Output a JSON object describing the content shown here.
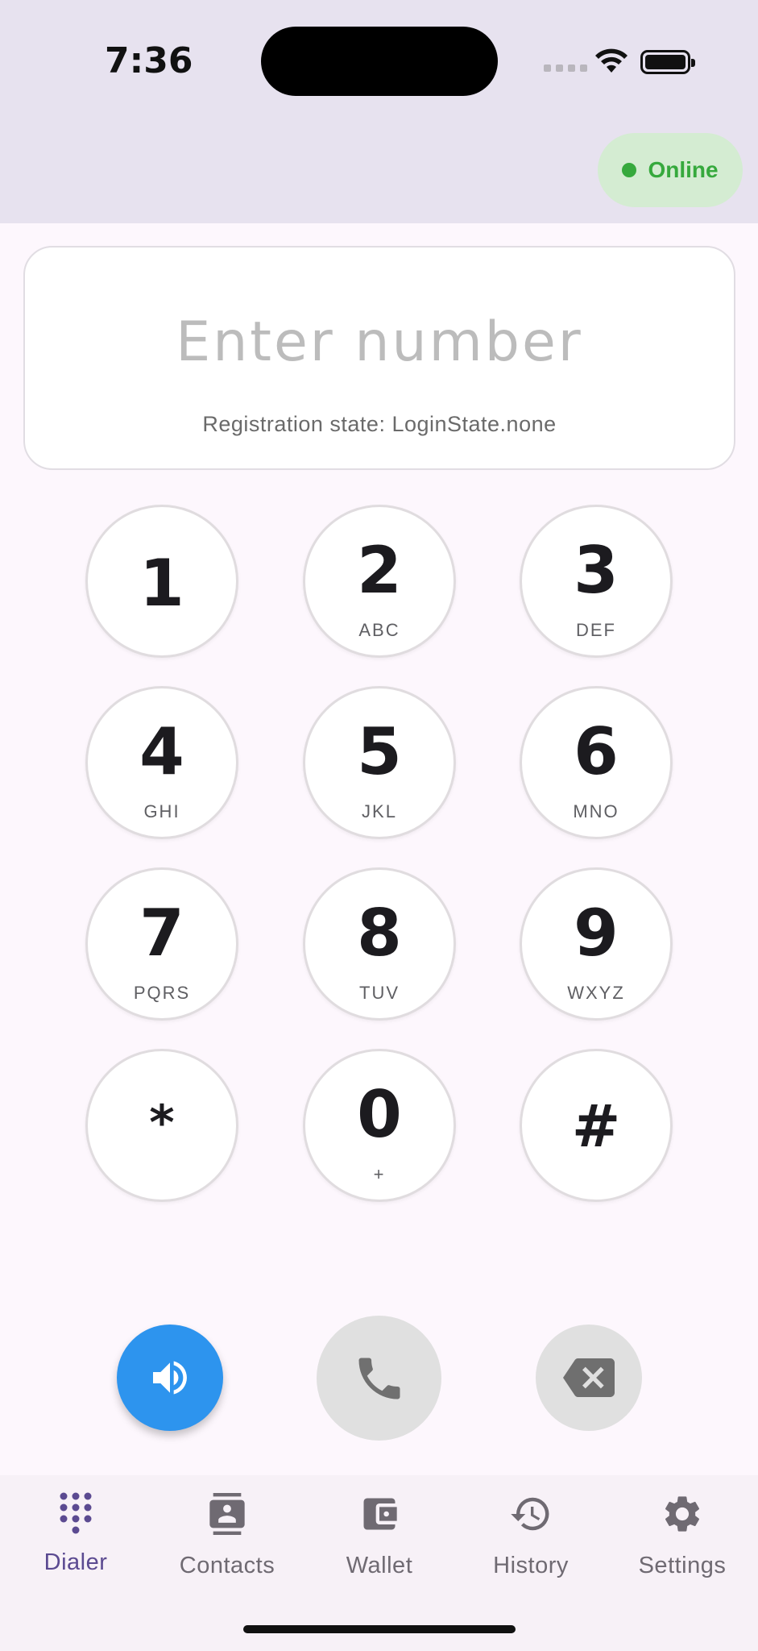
{
  "status_bar": {
    "time": "7:36"
  },
  "connection": {
    "label": "Online",
    "color": "#36a93d"
  },
  "dialer": {
    "number_placeholder": "Enter number",
    "number_value": "",
    "registration_state": "Registration state: LoginState.none"
  },
  "keypad": [
    {
      "digit": "1",
      "letters": ""
    },
    {
      "digit": "2",
      "letters": "ABC"
    },
    {
      "digit": "3",
      "letters": "DEF"
    },
    {
      "digit": "4",
      "letters": "GHI"
    },
    {
      "digit": "5",
      "letters": "JKL"
    },
    {
      "digit": "6",
      "letters": "MNO"
    },
    {
      "digit": "7",
      "letters": "PQRS"
    },
    {
      "digit": "8",
      "letters": "TUV"
    },
    {
      "digit": "9",
      "letters": "WXYZ"
    },
    {
      "digit": "*",
      "letters": ""
    },
    {
      "digit": "0",
      "letters": "+"
    },
    {
      "digit": "#",
      "letters": ""
    }
  ],
  "actions": {
    "speaker_icon": "speaker-icon",
    "call_icon": "phone-icon",
    "backspace_icon": "backspace-icon",
    "speaker_color": "#2d94ee"
  },
  "nav": {
    "items": [
      {
        "label": "Dialer",
        "icon": "dialpad-icon",
        "active": true
      },
      {
        "label": "Contacts",
        "icon": "contacts-icon",
        "active": false
      },
      {
        "label": "Wallet",
        "icon": "wallet-icon",
        "active": false
      },
      {
        "label": "History",
        "icon": "history-icon",
        "active": false
      },
      {
        "label": "Settings",
        "icon": "gear-icon",
        "active": false
      }
    ],
    "active_color": "#5b4a91"
  }
}
